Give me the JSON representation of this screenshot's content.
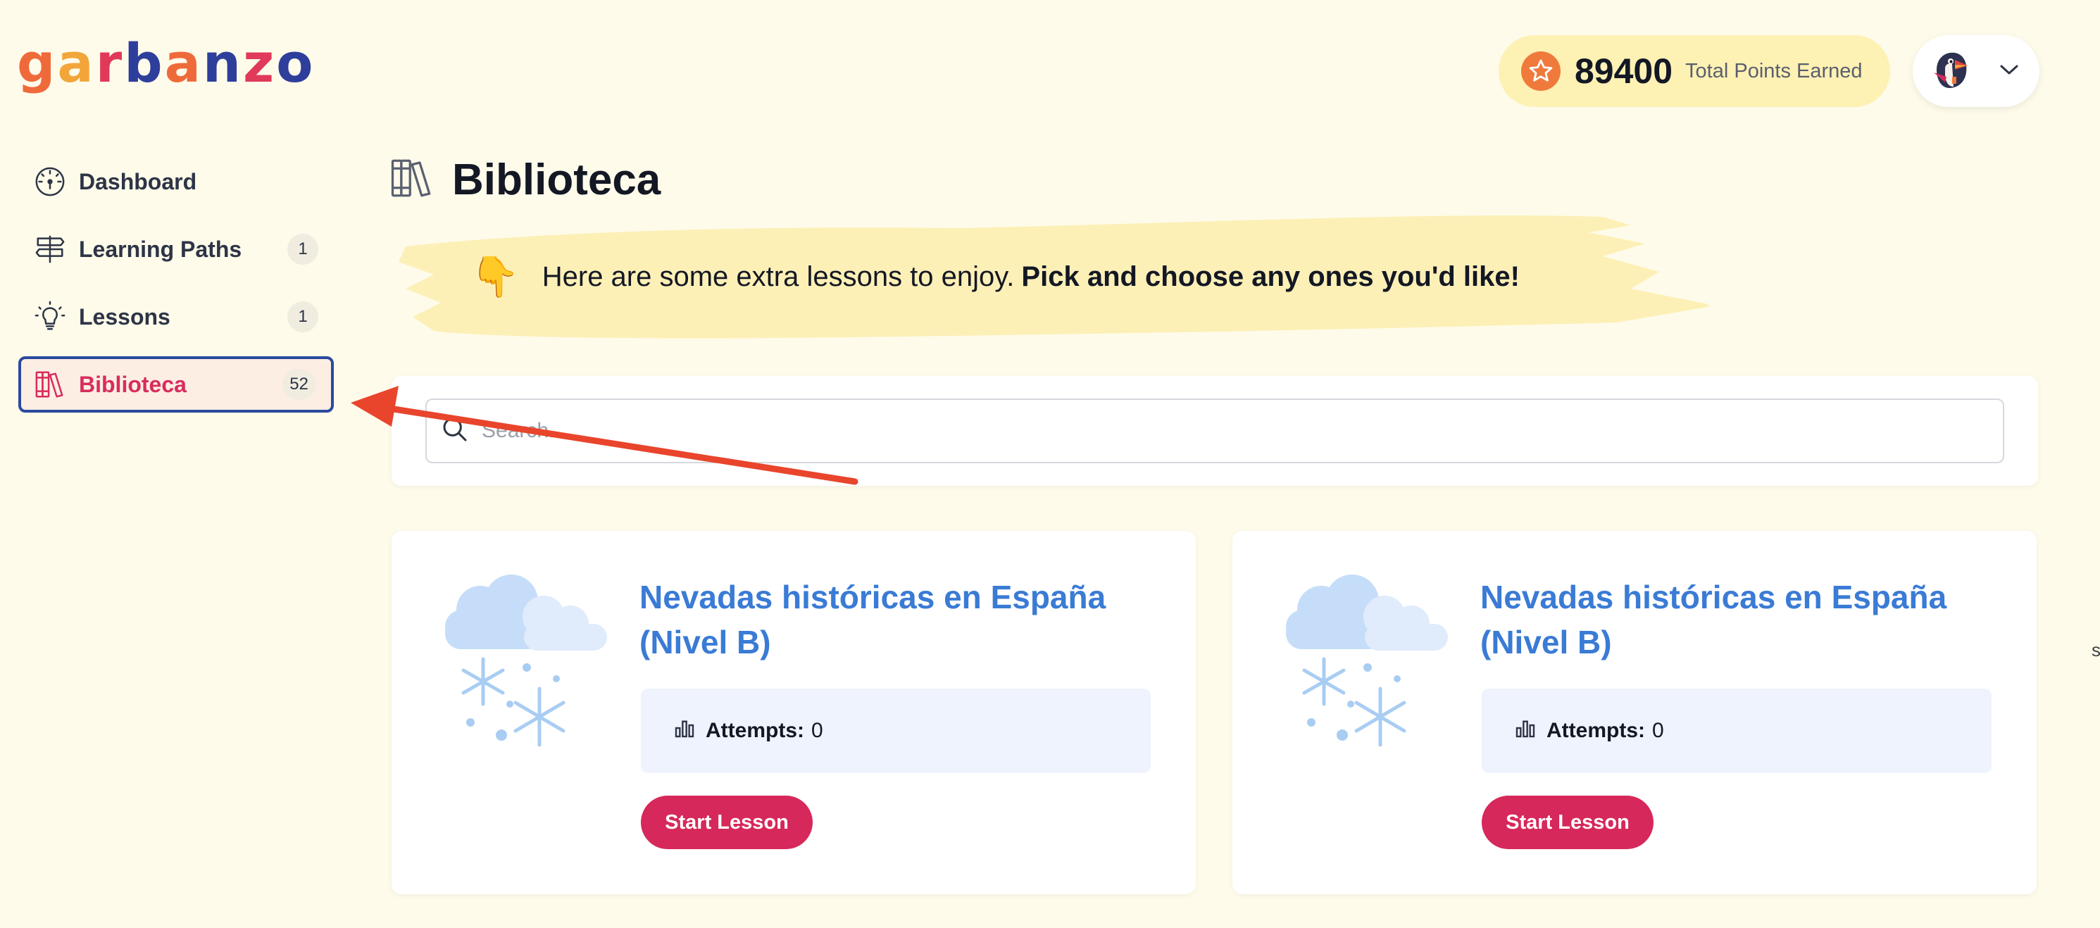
{
  "brand": {
    "letters": [
      "g",
      "a",
      "r",
      "b",
      "a",
      "n",
      "z",
      "o"
    ],
    "letter_colors": [
      "#ef6a3b",
      "#f2a63a",
      "#e0395a",
      "#2e3e9b",
      "#ef6a3b",
      "#2e3e9b",
      "#e0395a",
      "#2e3e9b"
    ]
  },
  "sidebar": {
    "items": [
      {
        "label": "Dashboard",
        "icon": "dashboard-gauge-icon",
        "badge": ""
      },
      {
        "label": "Learning Paths",
        "icon": "signpost-icon",
        "badge": "1"
      },
      {
        "label": "Lessons",
        "icon": "lightbulb-icon",
        "badge": "1"
      },
      {
        "label": "Biblioteca",
        "icon": "books-icon",
        "badge": "52",
        "active": true
      }
    ]
  },
  "header": {
    "points_value": "89400",
    "points_label": "Total Points Earned",
    "star_icon": "star-icon",
    "avatar_icon": "puffin-avatar-icon",
    "menu_icon": "chevron-down-icon"
  },
  "page": {
    "title": "Biblioteca",
    "title_icon": "books-icon"
  },
  "banner": {
    "emoji": "👇",
    "text": "Here are some extra lessons to enjoy.",
    "strong": "Pick and choose any ones you'd like!"
  },
  "search": {
    "placeholder": "Search..."
  },
  "lessons": [
    {
      "title": "Nevadas históricas en España (Nivel B)",
      "attempts_label": "Attempts:",
      "attempts_value": "0",
      "button": "Start Lesson",
      "art_icon": "snow-cloud-icon"
    },
    {
      "title": "Nevadas históricas en España (Nivel B)",
      "attempts_label": "Attempts:",
      "attempts_value": "0",
      "button": "Start Lesson",
      "art_icon": "snow-cloud-icon"
    }
  ],
  "edge_glyph": "s",
  "colors": {
    "background": "#fefbea",
    "accent_pink": "#d6285a",
    "link_blue": "#3a7bd5",
    "active_border": "#2a4a9e",
    "annotation_arrow": "#e8452c"
  }
}
